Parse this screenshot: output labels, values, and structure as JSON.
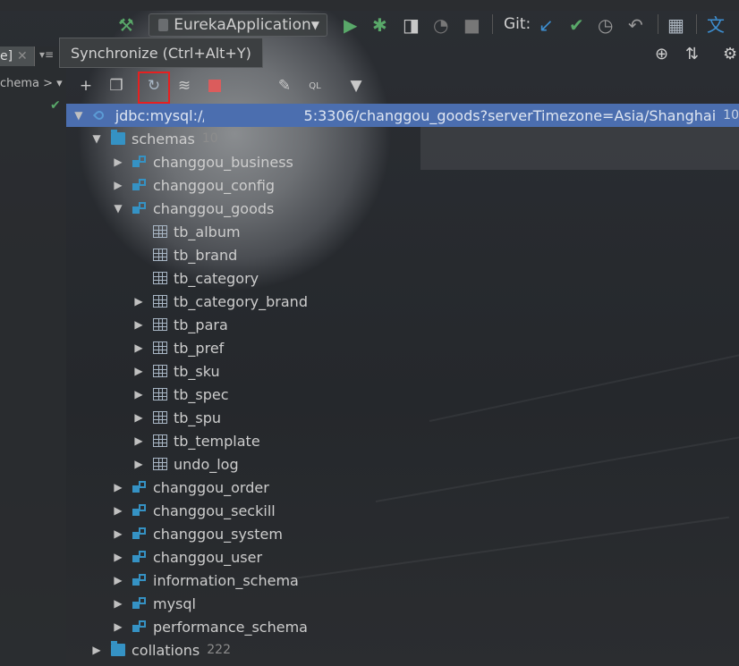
{
  "toolbar": {
    "run_config": "EurekaApplication",
    "git_label": "Git:"
  },
  "tooltip": {
    "text": "Synchronize (Ctrl+Alt+Y)"
  },
  "left_panel": {
    "tab_label": "e]",
    "schema_dropdown": "chema >"
  },
  "tree": {
    "connection": {
      "url_prefix": "jdbc:mysql://",
      "url_suffix": "5:3306/changgou_goods?serverTimezone=Asia/Shanghai",
      "count": "10"
    },
    "schemas_label": "schemas",
    "schemas_count": "10",
    "schema_rows_before": [
      "changgou_business",
      "changgou_config"
    ],
    "open_schema": "changgou_goods",
    "tables": [
      "tb_album",
      "tb_brand",
      "tb_category",
      "tb_category_brand",
      "tb_para",
      "tb_pref",
      "tb_sku",
      "tb_spec",
      "tb_spu",
      "tb_template",
      "undo_log"
    ],
    "schema_rows_after": [
      "changgou_order",
      "changgou_seckill",
      "changgou_system",
      "changgou_user",
      "information_schema",
      "mysql",
      "performance_schema"
    ],
    "collations_label": "collations",
    "collations_count": "222"
  },
  "colors": {
    "selection": "#4b6eaf",
    "highlight_box": "#e62020",
    "run_green": "#59a869",
    "stop_red": "#db5c5c"
  }
}
